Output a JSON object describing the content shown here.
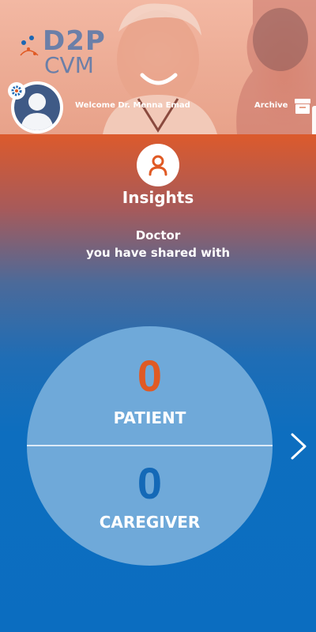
{
  "header": {
    "logo_line1": "D2P",
    "logo_line2": "CVM",
    "welcome": "Welcome Dr. Menna Emad",
    "archive_label": "Archive"
  },
  "insights": {
    "title": "Insights",
    "subtitle_line1": "Doctor",
    "subtitle_line2": "you have shared with"
  },
  "stats": {
    "patient_count": "0",
    "patient_label": "PATIENT",
    "caregiver_count": "0",
    "caregiver_label": "CAREGIVER"
  },
  "colors": {
    "accent_orange": "#e05a24",
    "accent_blue": "#1469b7",
    "circle_fill": "#6fa9d9"
  },
  "icons": [
    "gear-icon",
    "archive-icon",
    "user-icon",
    "chevron-right-icon",
    "avatar-icon"
  ]
}
